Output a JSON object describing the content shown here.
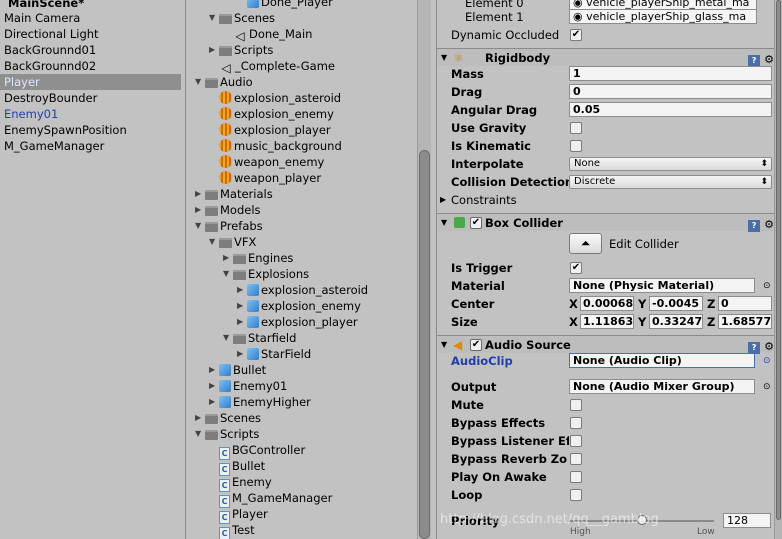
{
  "hierarchy": {
    "scene_name": "MainScene*",
    "items": [
      {
        "label": "Main Camera",
        "state": "normal"
      },
      {
        "label": "Directional Light",
        "state": "normal"
      },
      {
        "label": "BackGrounnd01",
        "state": "normal"
      },
      {
        "label": "BackGrounnd02",
        "state": "normal"
      },
      {
        "label": "Player",
        "state": "selected"
      },
      {
        "label": "DestroyBounder",
        "state": "normal"
      },
      {
        "label": "Enemy01",
        "state": "prefab"
      },
      {
        "label": "EnemySpawnPosition",
        "state": "normal"
      },
      {
        "label": "M_GameManager",
        "state": "normal"
      }
    ]
  },
  "project": {
    "items": [
      {
        "label": "Done_Player",
        "icon": "prefab-icon",
        "indent": 3,
        "arrow": ""
      },
      {
        "label": "Scenes",
        "icon": "folder-icon",
        "indent": 1,
        "arrow": "▼"
      },
      {
        "label": "Done_Main",
        "icon": "unity-scene-icon",
        "indent": 2,
        "arrow": ""
      },
      {
        "label": "Scripts",
        "icon": "folder-icon",
        "indent": 1,
        "arrow": "▶"
      },
      {
        "label": "_Complete-Game",
        "icon": "unity-scene-icon",
        "indent": 1,
        "arrow": ""
      },
      {
        "label": "Audio",
        "icon": "folder-icon",
        "indent": 0,
        "arrow": "▼"
      },
      {
        "label": "explosion_asteroid",
        "icon": "audio-icon",
        "indent": 1,
        "arrow": ""
      },
      {
        "label": "explosion_enemy",
        "icon": "audio-icon",
        "indent": 1,
        "arrow": ""
      },
      {
        "label": "explosion_player",
        "icon": "audio-icon",
        "indent": 1,
        "arrow": ""
      },
      {
        "label": "music_background",
        "icon": "audio-icon",
        "indent": 1,
        "arrow": ""
      },
      {
        "label": "weapon_enemy",
        "icon": "audio-icon",
        "indent": 1,
        "arrow": ""
      },
      {
        "label": "weapon_player",
        "icon": "audio-icon",
        "indent": 1,
        "arrow": ""
      },
      {
        "label": "Materials",
        "icon": "folder-icon",
        "indent": 0,
        "arrow": "▶"
      },
      {
        "label": "Models",
        "icon": "folder-icon",
        "indent": 0,
        "arrow": "▶"
      },
      {
        "label": "Prefabs",
        "icon": "folder-icon",
        "indent": 0,
        "arrow": "▼"
      },
      {
        "label": "VFX",
        "icon": "folder-icon",
        "indent": 1,
        "arrow": "▼"
      },
      {
        "label": "Engines",
        "icon": "folder-icon",
        "indent": 2,
        "arrow": "▶"
      },
      {
        "label": "Explosions",
        "icon": "folder-icon",
        "indent": 2,
        "arrow": "▼"
      },
      {
        "label": "explosion_asteroid",
        "icon": "prefab-icon",
        "indent": 3,
        "arrow": "▶"
      },
      {
        "label": "explosion_enemy",
        "icon": "prefab-icon",
        "indent": 3,
        "arrow": "▶"
      },
      {
        "label": "explosion_player",
        "icon": "prefab-icon",
        "indent": 3,
        "arrow": "▶"
      },
      {
        "label": "Starfield",
        "icon": "folder-icon",
        "indent": 2,
        "arrow": "▼"
      },
      {
        "label": "StarField",
        "icon": "prefab-icon",
        "indent": 3,
        "arrow": "▶"
      },
      {
        "label": "Bullet",
        "icon": "prefab-icon",
        "indent": 1,
        "arrow": "▶"
      },
      {
        "label": "Enemy01",
        "icon": "prefab-icon",
        "indent": 1,
        "arrow": "▶"
      },
      {
        "label": "EnemyHigher",
        "icon": "prefab-icon",
        "indent": 1,
        "arrow": "▶"
      },
      {
        "label": "Scenes",
        "icon": "folder-icon",
        "indent": 0,
        "arrow": "▶"
      },
      {
        "label": "Scripts",
        "icon": "folder-icon",
        "indent": 0,
        "arrow": "▼"
      },
      {
        "label": "BGController",
        "icon": "script-icon",
        "indent": 1,
        "arrow": ""
      },
      {
        "label": "Bullet",
        "icon": "script-icon",
        "indent": 1,
        "arrow": ""
      },
      {
        "label": "Enemy",
        "icon": "script-icon",
        "indent": 1,
        "arrow": ""
      },
      {
        "label": "M_GameManager",
        "icon": "script-icon",
        "indent": 1,
        "arrow": ""
      },
      {
        "label": "Player",
        "icon": "script-icon",
        "indent": 1,
        "arrow": ""
      },
      {
        "label": "Test",
        "icon": "script-icon",
        "indent": 1,
        "arrow": ""
      }
    ]
  },
  "inspector": {
    "top": {
      "element0_label": "Element 0",
      "element0_value": "vehicle_playerShip_metal_ma",
      "element1_label": "Element 1",
      "element1_value": "vehicle_playerShip_glass_ma",
      "dynamic_occluded_label": "Dynamic Occluded",
      "dynamic_occluded_checked": "✔"
    },
    "rigidbody": {
      "title": "Rigidbody",
      "mass_label": "Mass",
      "mass": "1",
      "drag_label": "Drag",
      "drag": "0",
      "angular_drag_label": "Angular Drag",
      "angular_drag": "0.05",
      "use_gravity_label": "Use Gravity",
      "is_kinematic_label": "Is Kinematic",
      "interpolate_label": "Interpolate",
      "interpolate": "None",
      "collision_label": "Collision Detection",
      "collision": "Discrete",
      "constraints_label": "Constraints"
    },
    "box_collider": {
      "title": "Box Collider",
      "enabled": "✔",
      "edit_label": "Edit Collider",
      "is_trigger_label": "Is Trigger",
      "is_trigger": "✔",
      "material_label": "Material",
      "material": "None (Physic Material)",
      "center_label": "Center",
      "center": {
        "x": "0.00068",
        "y": "-0.0045",
        "z": "0"
      },
      "size_label": "Size",
      "size": {
        "x": "1.11863",
        "y": "0.33247",
        "z": "1.68577"
      }
    },
    "audio_source": {
      "title": "Audio Source",
      "enabled": "✔",
      "clip_label": "AudioClip",
      "clip": "None (Audio Clip)",
      "output_label": "Output",
      "output": "None (Audio Mixer Group)",
      "mute_label": "Mute",
      "bypass_effects_label": "Bypass Effects",
      "bypass_listener_label": "Bypass Listener Ef",
      "bypass_reverb_label": "Bypass Reverb Zo",
      "play_on_awake_label": "Play On Awake",
      "loop_label": "Loop",
      "priority_label": "Priority",
      "priority": "128",
      "priority_level": 0.5,
      "high_label": "High",
      "low_label": "Low"
    },
    "axis": {
      "x": "X",
      "y": "Y",
      "z": "Z"
    }
  },
  "watermark": "http://blog.csdn.net/qq__gamblog"
}
